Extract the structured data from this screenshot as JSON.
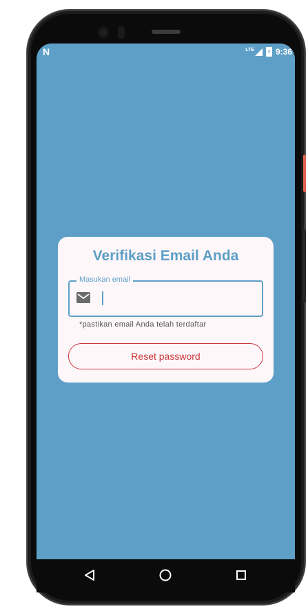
{
  "status_bar": {
    "left_icon": "N",
    "network": "LTE",
    "time": "9:36"
  },
  "card": {
    "title": "Verifikasi Email Anda",
    "email_field": {
      "label": "Masukan email",
      "value": "",
      "icon": "mail-icon"
    },
    "helper_text": "*pastikan email Anda telah terdaftar",
    "reset_button_label": "Reset password"
  },
  "nav": {
    "back_icon": "back-triangle-icon",
    "home_icon": "home-circle-icon",
    "recents_icon": "recents-square-icon"
  },
  "colors": {
    "background": "#5e9fc7",
    "primary": "#5d9fc6",
    "accent_red": "#c9363b",
    "card": "#fef7fa"
  }
}
